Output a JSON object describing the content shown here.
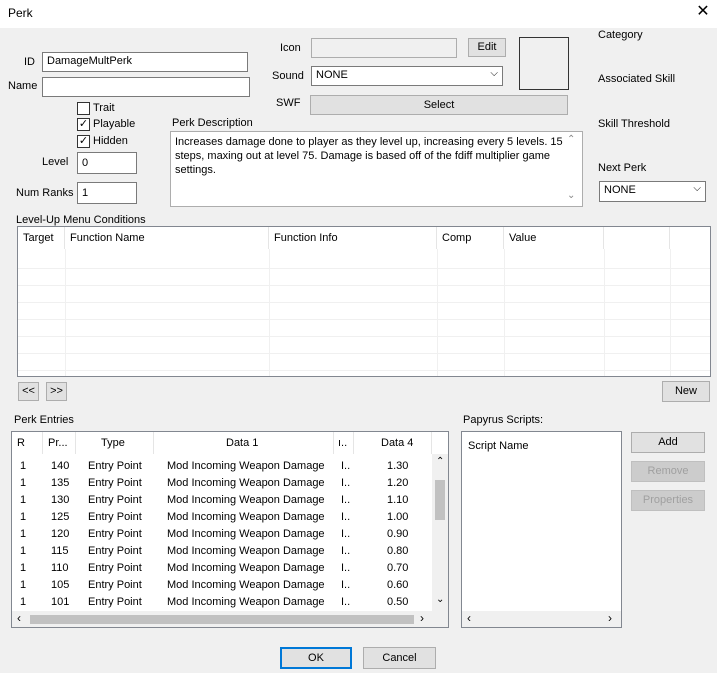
{
  "window": {
    "title": "Perk",
    "close_glyph": "✕"
  },
  "labels": {
    "id": "ID",
    "name": "Name",
    "icon": "Icon",
    "sound": "Sound",
    "swf": "SWF",
    "category": "Category",
    "associated_skill": "Associated Skill",
    "skill_threshold": "Skill Threshold",
    "next_perk": "Next Perk",
    "perk_description": "Perk Description",
    "level": "Level",
    "num_ranks": "Num Ranks",
    "level_up_conditions": "Level-Up Menu Conditions",
    "perk_entries": "Perk Entries",
    "papyrus_scripts": "Papyrus Scripts:"
  },
  "fields": {
    "id_value": "DamageMultPerk",
    "name_value": "",
    "icon_value": "",
    "sound_value": "NONE",
    "level_value": "0",
    "num_ranks_value": "1",
    "next_perk_value": "NONE",
    "description": "Increases damage done to player as they level up, increasing every 5 levels. 15 steps, maxing out at level 75. Damage is based off of the fdiff multiplier game settings."
  },
  "checkboxes": [
    {
      "label": "Trait",
      "checked": false
    },
    {
      "label": "Playable",
      "checked": true
    },
    {
      "label": "Hidden",
      "checked": true
    }
  ],
  "buttons": {
    "edit": "Edit",
    "select": "Select",
    "prev": "<<",
    "next": ">>",
    "new": "New",
    "add": "Add",
    "remove": "Remove",
    "properties": "Properties",
    "ok": "OK",
    "cancel": "Cancel"
  },
  "conditions_table": {
    "columns": [
      "Target",
      "Function Name",
      "Function Info",
      "Comp",
      "Value"
    ],
    "rows": []
  },
  "entries_table": {
    "columns": [
      "R",
      "Pr...",
      "Type",
      "Data 1",
      "ı..",
      "Data 4"
    ],
    "rows": [
      [
        "1",
        "140",
        "Entry Point",
        "Mod Incoming Weapon Damage",
        "I..",
        "1.30"
      ],
      [
        "1",
        "135",
        "Entry Point",
        "Mod Incoming Weapon Damage",
        "I..",
        "1.20"
      ],
      [
        "1",
        "130",
        "Entry Point",
        "Mod Incoming Weapon Damage",
        "I..",
        "1.10"
      ],
      [
        "1",
        "125",
        "Entry Point",
        "Mod Incoming Weapon Damage",
        "I..",
        "1.00"
      ],
      [
        "1",
        "120",
        "Entry Point",
        "Mod Incoming Weapon Damage",
        "I..",
        "0.90"
      ],
      [
        "1",
        "115",
        "Entry Point",
        "Mod Incoming Weapon Damage",
        "I..",
        "0.80"
      ],
      [
        "1",
        "110",
        "Entry Point",
        "Mod Incoming Weapon Damage",
        "I..",
        "0.70"
      ],
      [
        "1",
        "105",
        "Entry Point",
        "Mod Incoming Weapon Damage",
        "I..",
        "0.60"
      ],
      [
        "1",
        "101",
        "Entry Point",
        "Mod Incoming Weapon Damage",
        "I..",
        "0.50"
      ]
    ]
  },
  "scripts_list": {
    "header": "Script Name",
    "items": []
  },
  "icons": {
    "check": "✓",
    "dropdown": "⌵",
    "up": "⌃",
    "down": "⌄",
    "left": "‹",
    "right": "›"
  }
}
